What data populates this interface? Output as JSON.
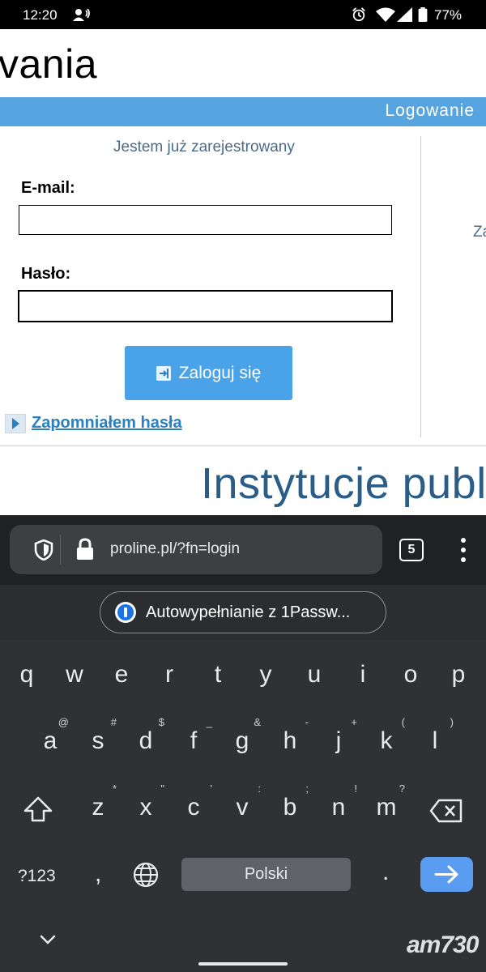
{
  "status_bar": {
    "time": "12:20",
    "battery": "77%"
  },
  "page": {
    "heading_fragment": "vania",
    "band_label": "Logowanie",
    "section_heading": "Jestem już zarejestrowany",
    "email_label": "E-mail:",
    "email_value": "",
    "password_label": "Hasło:",
    "password_value": "",
    "login_button": "Zaloguj się",
    "forgot_password_link": "Zapomniałem hasła",
    "right_column_fragment": "Za",
    "banner_title_fragment": "Instytucje public"
  },
  "browser": {
    "url": "proline.pl/?fn=login",
    "tab_count": "5"
  },
  "autofill": {
    "label": "Autowypełnianie z 1Passw..."
  },
  "keyboard": {
    "row1": [
      "q",
      "w",
      "e",
      "r",
      "t",
      "y",
      "u",
      "i",
      "o",
      "p"
    ],
    "row2": [
      "a",
      "s",
      "d",
      "f",
      "g",
      "h",
      "j",
      "k",
      "l"
    ],
    "row2_hints": [
      "@",
      "#",
      "$",
      "_",
      "&",
      "-",
      "+",
      "(",
      ")"
    ],
    "row3": [
      "z",
      "x",
      "c",
      "v",
      "b",
      "n",
      "m"
    ],
    "row3_hints": [
      "*",
      "\"",
      "'",
      ":",
      ";",
      "!",
      "?"
    ],
    "symbols_key": "?123",
    "comma_key": ",",
    "space_label": "Polski",
    "period_key": "."
  },
  "watermark": "am730",
  "colors": {
    "accent_blue": "#56a5e0",
    "button_blue": "#4aa3e8",
    "link_blue": "#2a7fbf",
    "enter_key_blue": "#5a9cf0",
    "keyboard_bg": "#303134"
  }
}
